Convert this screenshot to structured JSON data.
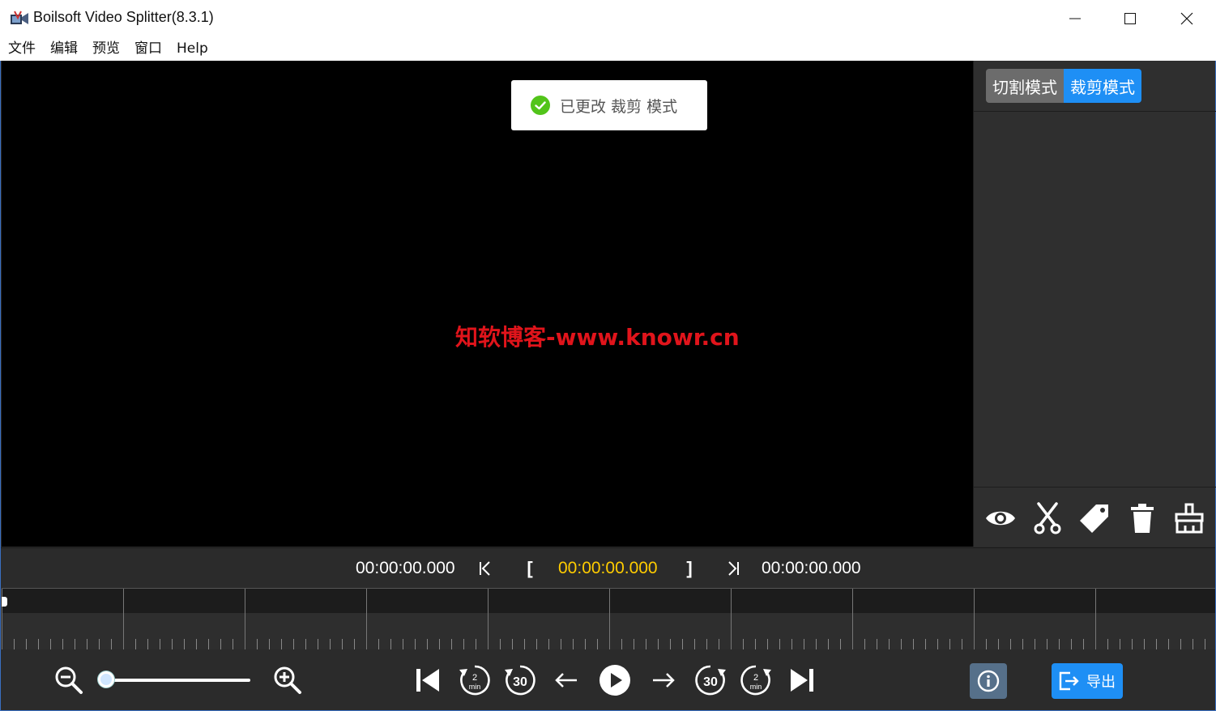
{
  "window": {
    "title": "Boilsoft Video Splitter(8.3.1)"
  },
  "menu": {
    "items": [
      "文件",
      "编辑",
      "预览",
      "窗口",
      "Help"
    ]
  },
  "preview": {
    "toast_text": "已更改 裁剪 模式",
    "watermark": "知软博客-www.knowr.cn"
  },
  "side_panel": {
    "mode_cut_label": "切割模式",
    "mode_crop_label": "裁剪模式",
    "active_mode": "裁剪模式",
    "tools": [
      "eye-icon",
      "scissors-icon",
      "tag-icon",
      "trash-icon",
      "broom-icon"
    ]
  },
  "timebar": {
    "start": "00:00:00.000",
    "mark_in_label": "[",
    "current": "00:00:00.000",
    "mark_out_label": "]",
    "end": "00:00:00.000"
  },
  "controls": {
    "zoom_level": 0,
    "rewind_2min_label": "2",
    "rewind_2min_unit": "min",
    "rewind_30_label": "30",
    "forward_30_label": "30",
    "forward_2min_label": "2",
    "forward_2min_unit": "min",
    "export_label": "导出"
  },
  "colors": {
    "accent": "#1e8ff5",
    "current_time": "#ffcc00",
    "watermark": "#e0141b",
    "toast_check": "#52c41a"
  }
}
